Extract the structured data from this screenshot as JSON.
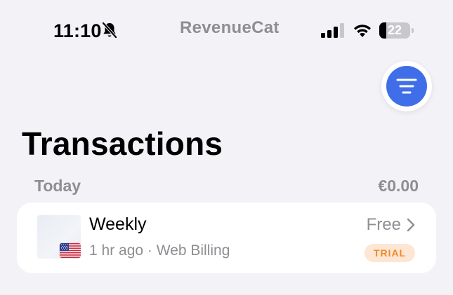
{
  "status_bar": {
    "time": "11:10",
    "battery_level": "22",
    "battery_fraction": 0.22,
    "icons": [
      "bell-slash-icon",
      "signal-icon",
      "wifi-icon",
      "battery-icon"
    ]
  },
  "header": {
    "brand": "RevenueCat"
  },
  "toolbar": {
    "filter_icon": "filter-icon",
    "accent_color": "#3f6ee8"
  },
  "page": {
    "title": "Transactions"
  },
  "sections": [
    {
      "label": "Today",
      "total": "€0.00",
      "transactions": [
        {
          "name": "Weekly",
          "time": "1 hr ago",
          "separator": "·",
          "source": "Web Billing",
          "amount": "Free",
          "badge": "TRIAL",
          "badge_color": "#ef8a2c",
          "country_icon": "us-flag-icon"
        }
      ]
    }
  ]
}
